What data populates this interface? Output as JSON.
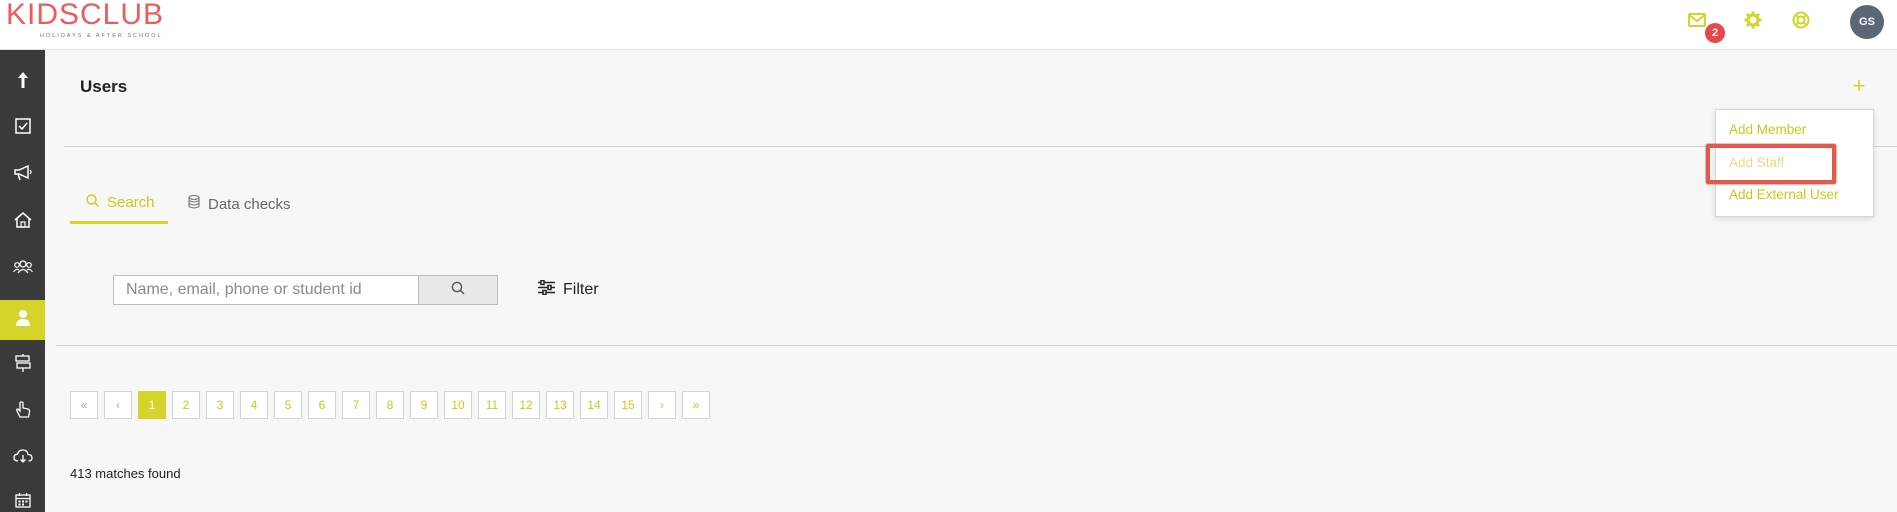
{
  "brand": {
    "logo_text": "KIDSCLUB",
    "logo_sub": "HOLIDAYS & AFTER SCHOOL"
  },
  "topbar": {
    "icons": [
      "mail-icon",
      "gear-icon",
      "lifebuoy-icon"
    ],
    "notification_count": "2",
    "avatar_initials": "GS"
  },
  "sidebar": {
    "items": [
      {
        "icon": "arrow-up-icon"
      },
      {
        "icon": "checkbox-icon"
      },
      {
        "icon": "megaphone-icon"
      },
      {
        "icon": "home-icon"
      },
      {
        "icon": "group-icon"
      },
      {
        "icon": "user-icon",
        "active": true
      },
      {
        "icon": "signpost-icon"
      },
      {
        "icon": "pointer-hand-icon"
      },
      {
        "icon": "cloud-download-icon"
      },
      {
        "icon": "calendar-icon"
      }
    ]
  },
  "page": {
    "title": "Users",
    "add_button": "+"
  },
  "tabs": [
    {
      "label": "Search",
      "active": true
    },
    {
      "label": "Data checks"
    }
  ],
  "search": {
    "placeholder": "Name, email, phone or student id",
    "filter_label": "Filter"
  },
  "pagination": {
    "first": "«",
    "prev": "‹",
    "pages": [
      "1",
      "2",
      "3",
      "4",
      "5",
      "6",
      "7",
      "8",
      "9",
      "10",
      "11",
      "12",
      "13",
      "14",
      "15"
    ],
    "current": "1",
    "next": "›",
    "last": "»"
  },
  "results": {
    "matches_text": "413 matches found"
  },
  "add_menu": {
    "items": [
      "Add Member",
      "Add Staff",
      "Add External User"
    ]
  },
  "colors": {
    "accent": "#d4d42a",
    "sidebar_bg": "#3a3a3a",
    "badge": "#e8484a",
    "brand": "#f05a5a",
    "highlight": "#e05a4e"
  }
}
